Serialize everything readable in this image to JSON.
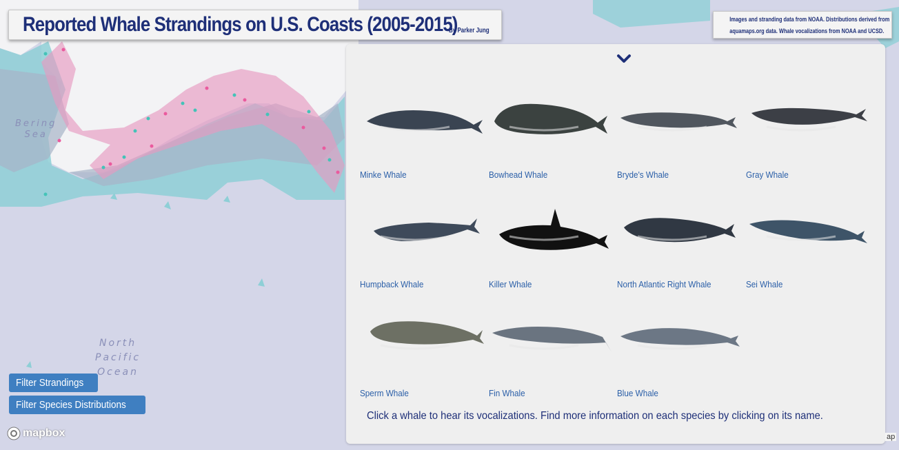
{
  "title": "Reported Whale Strandings on U.S. Coasts (2005-2015)",
  "byline": "By Parker Jung",
  "credits": {
    "line1": "Images and stranding data from NOAA. Distributions derived from",
    "line2": "aquamaps.org data.  Whale vocalizations from NOAA and UCSD."
  },
  "map_labels": {
    "bering": [
      "Bering",
      "Sea"
    ],
    "pacific": [
      "North",
      "Pacific",
      "Ocean"
    ]
  },
  "panel": {
    "collapse_icon": "chevron-down-icon",
    "whales": [
      {
        "name": "Minke Whale",
        "color": "#3a4452"
      },
      {
        "name": "Bowhead Whale",
        "color": "#3b4240"
      },
      {
        "name": "Bryde's Whale",
        "color": "#50565e"
      },
      {
        "name": "Gray Whale",
        "color": "#3c3f46"
      },
      {
        "name": "Humpback Whale",
        "color": "#3e4a5a"
      },
      {
        "name": "Killer Whale",
        "color": "#111111"
      },
      {
        "name": "North Atlantic Right Whale",
        "color": "#303843"
      },
      {
        "name": "Sei Whale",
        "color": "#3e5468"
      },
      {
        "name": "Sperm Whale",
        "color": "#6d7064"
      },
      {
        "name": "Fin Whale",
        "color": "#6a7480"
      },
      {
        "name": "Blue Whale",
        "color": "#6c7785"
      }
    ],
    "instruction": "Click a whale to hear its vocalizations. Find more information on each species by clicking on its name."
  },
  "buttons": {
    "filter_strandings": "Filter Strandings",
    "filter_species": "Filter Species Distributions"
  },
  "logo": "mapbox",
  "attribution": "ap",
  "colors": {
    "title": "#1e2f78",
    "link": "#2b5fa8",
    "button": "#3f7fc1",
    "distribution_teal": "#8ecfd6",
    "distribution_pink": "#e79ac0",
    "ocean": "#d4d6e8"
  }
}
